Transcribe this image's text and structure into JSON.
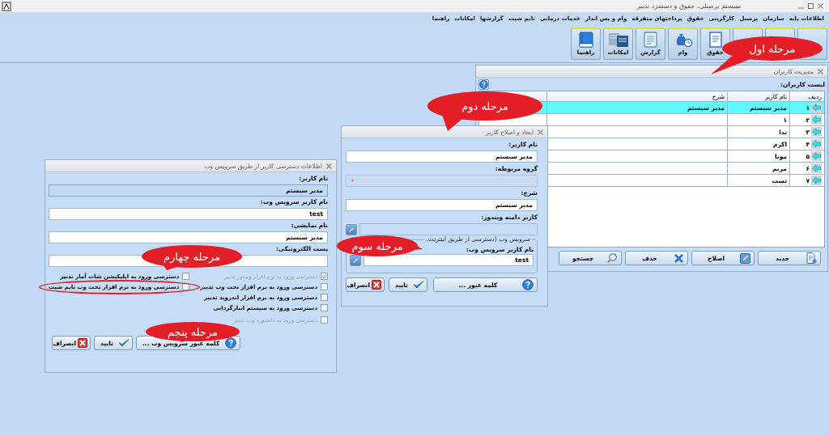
{
  "app_title": "سیستم پرسنلی، حقوق و دستمزد تدبیر",
  "menu": [
    "اطلاعات پایه",
    "سازمان",
    "پرسنل",
    "کارگزینی",
    "حقوق",
    "پرداختهای متفرقه",
    "وام و پس انداز",
    "خدمات درمانی",
    "تایم شیت",
    "گزارشها",
    "امکانات",
    "راهنما"
  ],
  "toolbar": {
    "buttons": [
      {
        "kind": "covered"
      },
      {
        "kind": "covered"
      },
      {
        "kind": "covered"
      },
      {
        "kind": "salary",
        "label": "حقوق"
      },
      {
        "kind": "loan",
        "label": "وام"
      },
      {
        "kind": "report",
        "label": "گزارش"
      },
      {
        "kind": "tools",
        "label": "امکانات"
      },
      {
        "kind": "help",
        "label": "راهنما"
      }
    ],
    "callout": "مرحله اول"
  },
  "users_window": {
    "title": "مدیریت کاربران",
    "list_label": "لیست کاربران:",
    "columns": [
      "ردیف",
      "نام کاربر",
      "شرح"
    ],
    "rows": [
      {
        "cells": [
          "۱",
          "مدیر سیستم",
          "مدیر سیستم"
        ],
        "selected": true
      },
      {
        "cells": [
          "۲",
          "۱",
          ""
        ],
        "selected": false
      },
      {
        "cells": [
          "۳",
          "ندا",
          ""
        ],
        "selected": false
      },
      {
        "cells": [
          "۴",
          "اکرم",
          ""
        ],
        "selected": false
      },
      {
        "cells": [
          "۵",
          "مونا",
          ""
        ],
        "selected": false
      },
      {
        "cells": [
          "۶",
          "مریم",
          ""
        ],
        "selected": false
      },
      {
        "cells": [
          "۷",
          "تست",
          ""
        ],
        "selected": false
      }
    ],
    "buttons": [
      {
        "kind": "new",
        "label": "جدید"
      },
      {
        "kind": "edit",
        "label": "اصلاح"
      },
      {
        "kind": "delete",
        "label": "حذف"
      },
      {
        "kind": "search",
        "label": "جستجو"
      }
    ],
    "callout": "مرحله دوم"
  },
  "edit_dialog": {
    "title": "ایجاد و اصلاح کاربر",
    "fields": [
      {
        "kind": "text",
        "label": "نام کاربر:",
        "value": "مدیر سیستم"
      },
      {
        "kind": "combo",
        "label": "گروه مربوطه:",
        "disabled": true
      },
      {
        "kind": "text",
        "label": "شرح:",
        "value": "مدیر سیستم"
      },
      {
        "kind": "picker",
        "label": "کاربر دامنه ویندوز:"
      }
    ],
    "web_group": {
      "legend": "سرویس وب (دسترسی از طریق اینترنت،",
      "label": "نام کاربر سرویس وب:",
      "value": "test"
    },
    "buttons": [
      {
        "kind": "password",
        "label": "کلمه عبور ..."
      },
      {
        "kind": "ok",
        "label": "تایید"
      },
      {
        "kind": "cancel",
        "label": "انصراف"
      }
    ],
    "callout": "مرحله سوم"
  },
  "web_dialog": {
    "title": "اطلاعات دسترسی کاربر از طریق سرویس وب",
    "fields": [
      {
        "kind": "readonly",
        "label": "نام کاربر:",
        "value": "مدیر سیستم"
      },
      {
        "kind": "text",
        "label": "نام کاربر سرویس وب:",
        "value": "test"
      },
      {
        "kind": "text",
        "label": "نام نمایشی:",
        "value": "مدیر سیستم"
      },
      {
        "kind": "text",
        "label": "پست الکترونیکی:"
      }
    ],
    "permissions_right": [
      {
        "label": "دسترسی ورود به نرم افزار ویندوز تدبیر",
        "checked": true,
        "disabled": true
      },
      {
        "label": "دسترسی ورود به نرم افزار تحت وب تدبیر",
        "checked": false,
        "disabled": false
      },
      {
        "label": "دسترسی ورود به نرم افزار اندروید تدبیر",
        "checked": false,
        "disabled": false
      },
      {
        "label": "دسترسی ورود به سیستم انبارگردانی",
        "checked": false,
        "disabled": false
      },
      {
        "label": "دسترسی ورود به داشبورد وب تدبیر",
        "checked": false,
        "disabled": true
      }
    ],
    "permissions_left": [
      {
        "label": "دسترسی ورود به اپلیکیشن شات آمار تدبیر",
        "checked": false,
        "disabled": false,
        "circled": false
      },
      {
        "label": "دسترسی ورود به نرم افزار تحت وب تایم شیت",
        "checked": false,
        "disabled": false,
        "circled": true
      }
    ],
    "buttons": [
      {
        "kind": "password",
        "label": "کلمه عبور سرویس وب ..."
      },
      {
        "kind": "ok",
        "label": "تایید"
      },
      {
        "kind": "cancel",
        "label": "انصراف"
      }
    ],
    "permissions_callout": "مرحله چهارم",
    "buttons_callout": "مرحله پنجم"
  }
}
